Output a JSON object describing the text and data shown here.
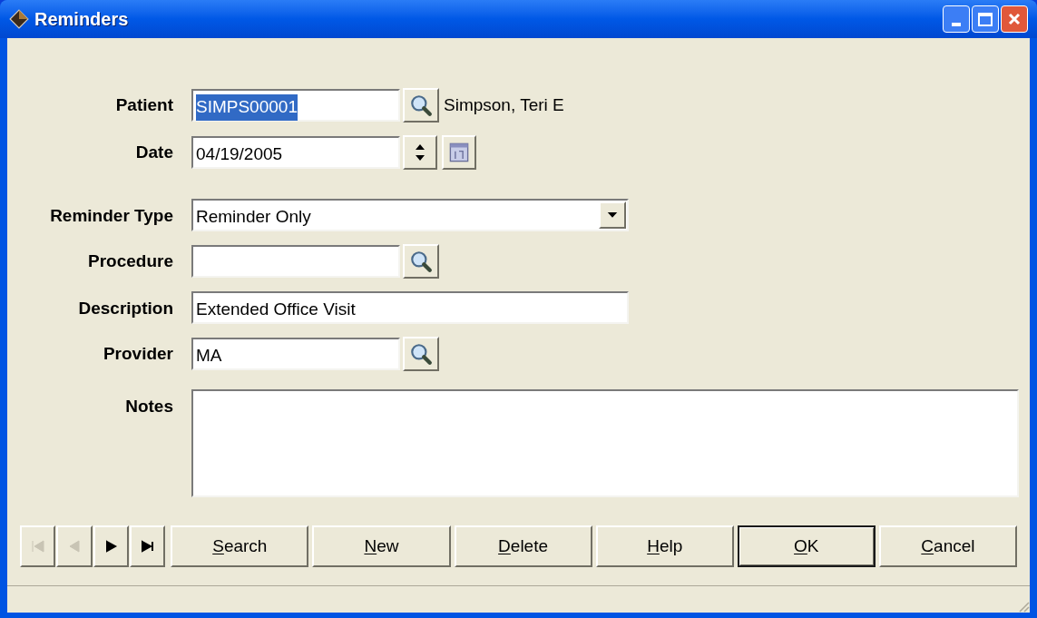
{
  "window": {
    "title": "Reminders"
  },
  "fields": [
    {
      "kind": "lookup",
      "label": "Patient",
      "value": "SIMPS00001",
      "text_selected": true,
      "note": "Simpson, Teri E"
    },
    {
      "kind": "date",
      "label": "Date",
      "value": "04/19/2005"
    },
    {
      "kind": "combo",
      "label": "Reminder Type",
      "value": "Reminder Only"
    },
    {
      "kind": "lookup",
      "label": "Procedure"
    },
    {
      "kind": "wide",
      "label": "Description",
      "value": "Extended Office Visit"
    },
    {
      "kind": "lookup",
      "label": "Provider",
      "value": "MA"
    },
    {
      "kind": "memo",
      "label": "Notes"
    }
  ],
  "nav_buttons": [
    {
      "kind": "first",
      "disabled": true
    },
    {
      "kind": "prev",
      "disabled": true
    },
    {
      "kind": "next",
      "disabled": false
    },
    {
      "kind": "last",
      "disabled": false
    }
  ],
  "buttons": [
    {
      "label": "Search",
      "default": false
    },
    {
      "label": "New",
      "default": false
    },
    {
      "label": "Delete",
      "default": false
    },
    {
      "label": "Help",
      "default": false
    },
    {
      "label": "OK",
      "default": true
    },
    {
      "label": "Cancel",
      "default": false
    }
  ]
}
